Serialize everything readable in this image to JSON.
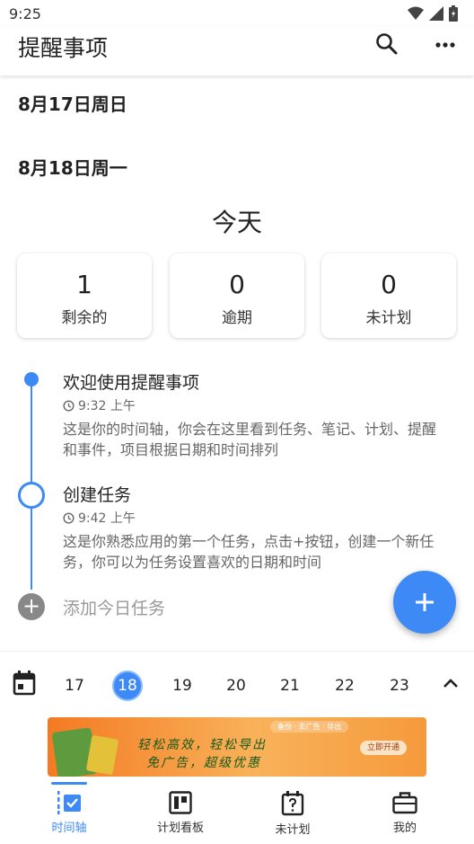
{
  "status_bar": {
    "time": "9:25"
  },
  "app_bar": {
    "title": "提醒事项"
  },
  "dates": {
    "date_1": "8月17日周日",
    "date_2": "8月18日周一"
  },
  "today": {
    "title": "今天",
    "stats": [
      {
        "value": "1",
        "label": "剩余的"
      },
      {
        "value": "0",
        "label": "逾期"
      },
      {
        "value": "0",
        "label": "未计划"
      }
    ]
  },
  "timeline": {
    "items": [
      {
        "title": "欢迎使用提醒事项",
        "time": "9:32 上午",
        "description": "这是你的时间轴，你会在这里看到任务、笔记、计划、提醒和事件，项目根据日期和时间排列"
      },
      {
        "title": "创建任务",
        "time": "9:42 上午",
        "description": "这是你熟悉应用的第一个任务，点击+按钮，创建一个新任务，你可以为任务设置喜欢的日期和时间"
      }
    ],
    "add_today_label": "添加今日任务"
  },
  "week": {
    "days": [
      "17",
      "18",
      "19",
      "20",
      "21",
      "22",
      "23"
    ],
    "selected_day": "18"
  },
  "ad": {
    "line_1": "轻松高效，轻松导出",
    "line_2": "免广告，超级优惠",
    "top_label": "备份 · 去广告 · 导出",
    "cta": "立即开通"
  },
  "bottom_nav": {
    "tabs": [
      {
        "label": "时间轴",
        "active": true
      },
      {
        "label": "计划看板",
        "active": false
      },
      {
        "label": "未计划",
        "active": false
      },
      {
        "label": "我的",
        "active": false
      }
    ]
  },
  "colors": {
    "accent": "#3d8af7",
    "ad_orange": "#f37a23"
  },
  "icons": [
    "wifi-icon",
    "signal-icon",
    "battery-icon",
    "search-icon",
    "more-icon",
    "clock-icon",
    "plus-icon",
    "calendar-icon",
    "chevron-up-icon",
    "timeline-icon",
    "board-icon",
    "unplanned-icon",
    "briefcase-icon"
  ]
}
